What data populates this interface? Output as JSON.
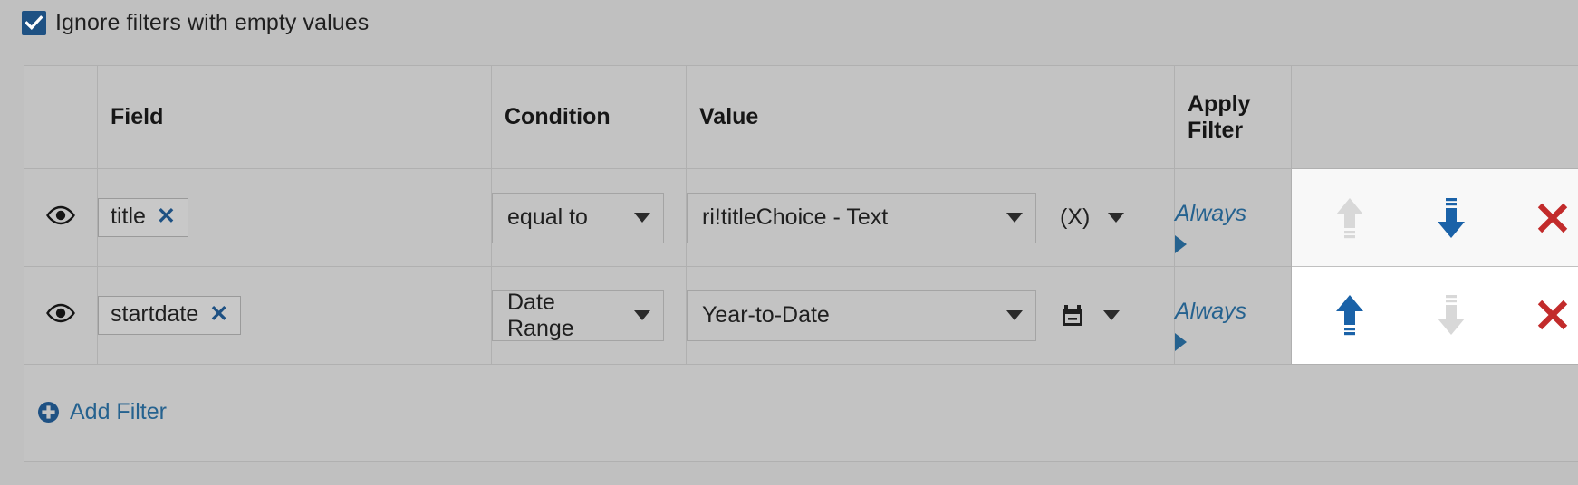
{
  "ignore_filters": {
    "label": "Ignore filters with empty values",
    "checked": true,
    "accent": "#1e5183"
  },
  "table": {
    "headers": {
      "eye": "",
      "field": "Field",
      "condition": "Condition",
      "value": "Value",
      "apply": "Apply Filter",
      "actions": ""
    },
    "rows": [
      {
        "visibility_icon": "eye-icon",
        "field": "title",
        "field_remove_icon": "x-icon",
        "condition": "equal to",
        "value": "ri!titleChoice - Text",
        "value_type": "(X)",
        "value_type_icon": "variable-icon",
        "apply_filter": "Always",
        "move_up_enabled": false,
        "move_down_enabled": true,
        "highlight": "#f8f8f8"
      },
      {
        "visibility_icon": "eye-icon",
        "field": "startdate",
        "field_remove_icon": "x-icon",
        "condition": "Date Range",
        "value": "Year-to-Date",
        "value_type": "",
        "value_type_icon": "calendar-icon",
        "apply_filter": "Always",
        "move_up_enabled": true,
        "move_down_enabled": false,
        "highlight": "#ffffff"
      }
    ],
    "add_filter": {
      "label": "Add Filter",
      "icon": "plus-circle-icon"
    }
  },
  "colors": {
    "link_blue": "#25628f",
    "accent_blue": "#1e5183",
    "arrow_blue": "#1a62a8",
    "delete_red": "#c22b2b",
    "disabled_gray": "#d6d6d6",
    "page_bg": "#c0c0c0",
    "cell_bg": "#c3c3c3",
    "border": "#b0b0b0"
  }
}
